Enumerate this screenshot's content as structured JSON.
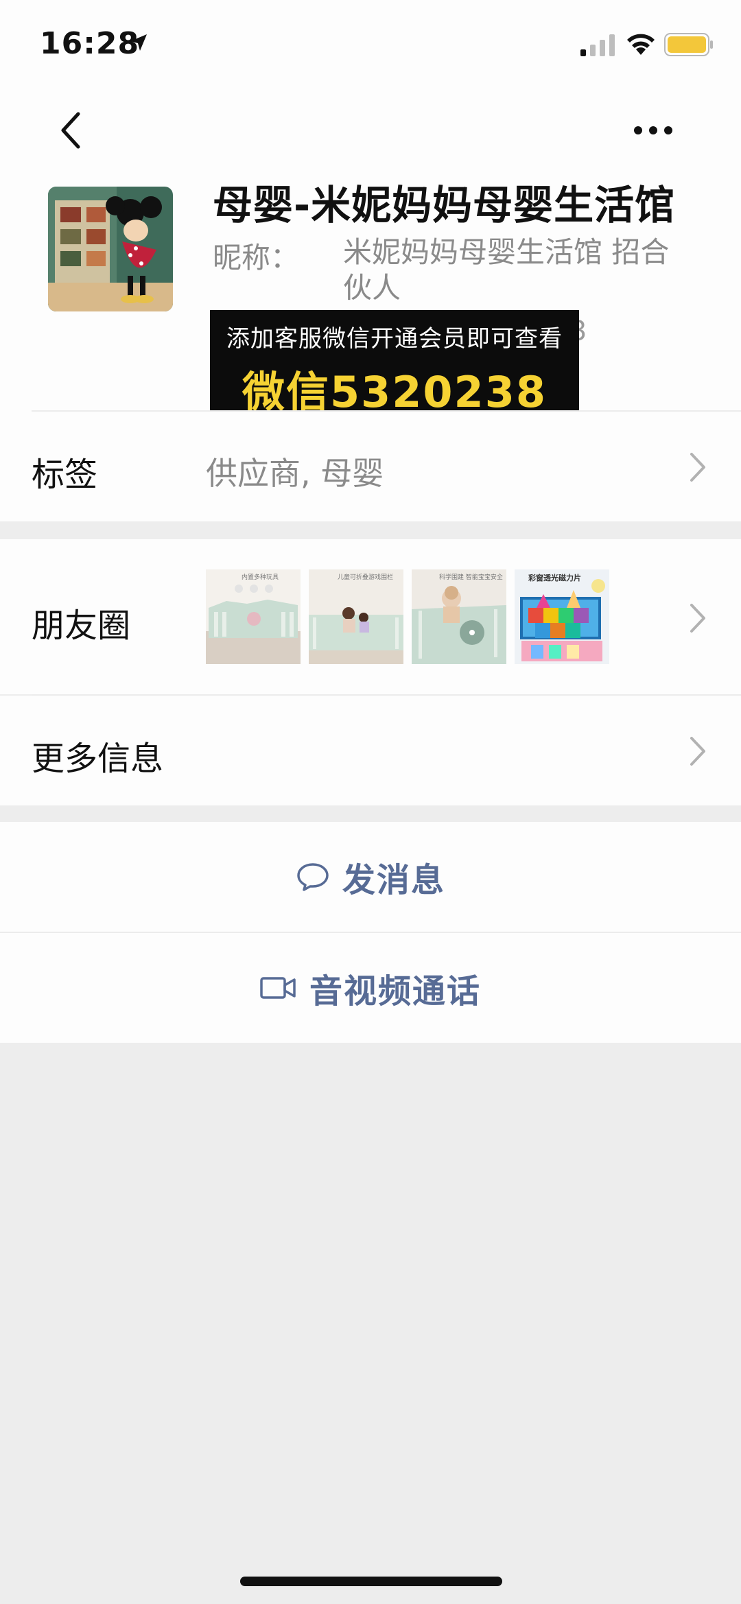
{
  "status_bar": {
    "time": "16:28",
    "icons": [
      "location-arrow-icon",
      "signal-icon",
      "wifi-icon",
      "battery-icon"
    ],
    "battery_color": "#f3c73a"
  },
  "nav": {
    "back_icon": "chevron-left-icon",
    "more_icon": "more-dots-icon"
  },
  "profile": {
    "name": "母婴-米妮妈妈母婴生活馆",
    "nickname_label": "昵称：",
    "nickname_value": "米妮妈妈母婴生活馆 招合伙人",
    "partial_id_tail": "3"
  },
  "overlay": {
    "line1": "添加客服微信开通会员即可查看",
    "line2": "微信5320238",
    "line2_color": "#f6d233"
  },
  "tags_row": {
    "label": "标签",
    "value": "供应商, 母婴"
  },
  "moments_row": {
    "label": "朋友圈",
    "thumbnails": [
      {
        "caption": "内置多种玩具"
      },
      {
        "caption": "儿童可折叠游戏围栏"
      },
      {
        "caption": "科学围建 智能宝宝安全"
      },
      {
        "caption": "彩窗透光磁力片"
      }
    ]
  },
  "more_info_row": {
    "label": "更多信息"
  },
  "actions": {
    "message_label": "发消息",
    "message_icon": "chat-bubble-icon",
    "video_label": "音视频通话",
    "video_icon": "video-camera-icon"
  },
  "colors": {
    "accent_link": "#576b95",
    "background": "#ededed",
    "card": "#fdfdfd"
  }
}
